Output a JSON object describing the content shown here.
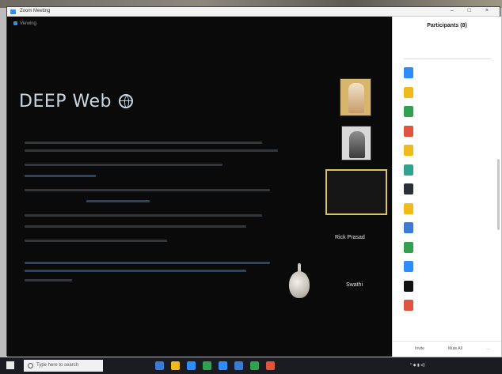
{
  "window": {
    "title": "Zoom Meeting",
    "controls": "– □ ×"
  },
  "share": {
    "label": "Viewing",
    "title": "DEEP Web"
  },
  "videos": {
    "tile1_name": "",
    "tile2_name": "",
    "active_name": "",
    "tile_a_name": "Rick Prasad",
    "tile_b_name": "Swathi"
  },
  "panel": {
    "title": "Participants (8)",
    "participants": [
      {
        "name": "",
        "color": "#2d8cff",
        "status": ""
      },
      {
        "name": "",
        "color": "#f2b91b",
        "status": ""
      },
      {
        "name": "",
        "color": "#30a24f",
        "status": ""
      },
      {
        "name": "",
        "color": "#e0533d",
        "status": ""
      },
      {
        "name": "",
        "color": "#f2b91b",
        "status": ""
      },
      {
        "name": "",
        "color": "#2ea38f",
        "status": ""
      },
      {
        "name": "",
        "color": "#2a2f3a",
        "status": ""
      },
      {
        "name": "",
        "color": "#f2b91b",
        "status": ""
      },
      {
        "name": "",
        "color": "#3a7bd5",
        "status": ""
      },
      {
        "name": "",
        "color": "#30a24f",
        "status": ""
      },
      {
        "name": "",
        "color": "#2d8cff",
        "status": ""
      },
      {
        "name": "",
        "color": "#111111",
        "status": ""
      },
      {
        "name": "",
        "color": "#e0533d",
        "status": ""
      }
    ],
    "footer_left": "Invite",
    "footer_mid": "Mute All"
  },
  "taskbar": {
    "search_placeholder": "Type here to search",
    "icons": [
      {
        "name": "task-view-icon",
        "color": "#3a7bd5"
      },
      {
        "name": "file-explorer-icon",
        "color": "#f2b91b"
      },
      {
        "name": "edge-icon",
        "color": "#2d8cff"
      },
      {
        "name": "chrome-icon",
        "color": "#30a24f"
      },
      {
        "name": "zoom-icon",
        "color": "#2d8cff"
      },
      {
        "name": "word-icon",
        "color": "#3a7bd5"
      },
      {
        "name": "excel-icon",
        "color": "#30a24f"
      },
      {
        "name": "powerpoint-icon",
        "color": "#e0533d"
      }
    ],
    "time": "",
    "date": ""
  }
}
